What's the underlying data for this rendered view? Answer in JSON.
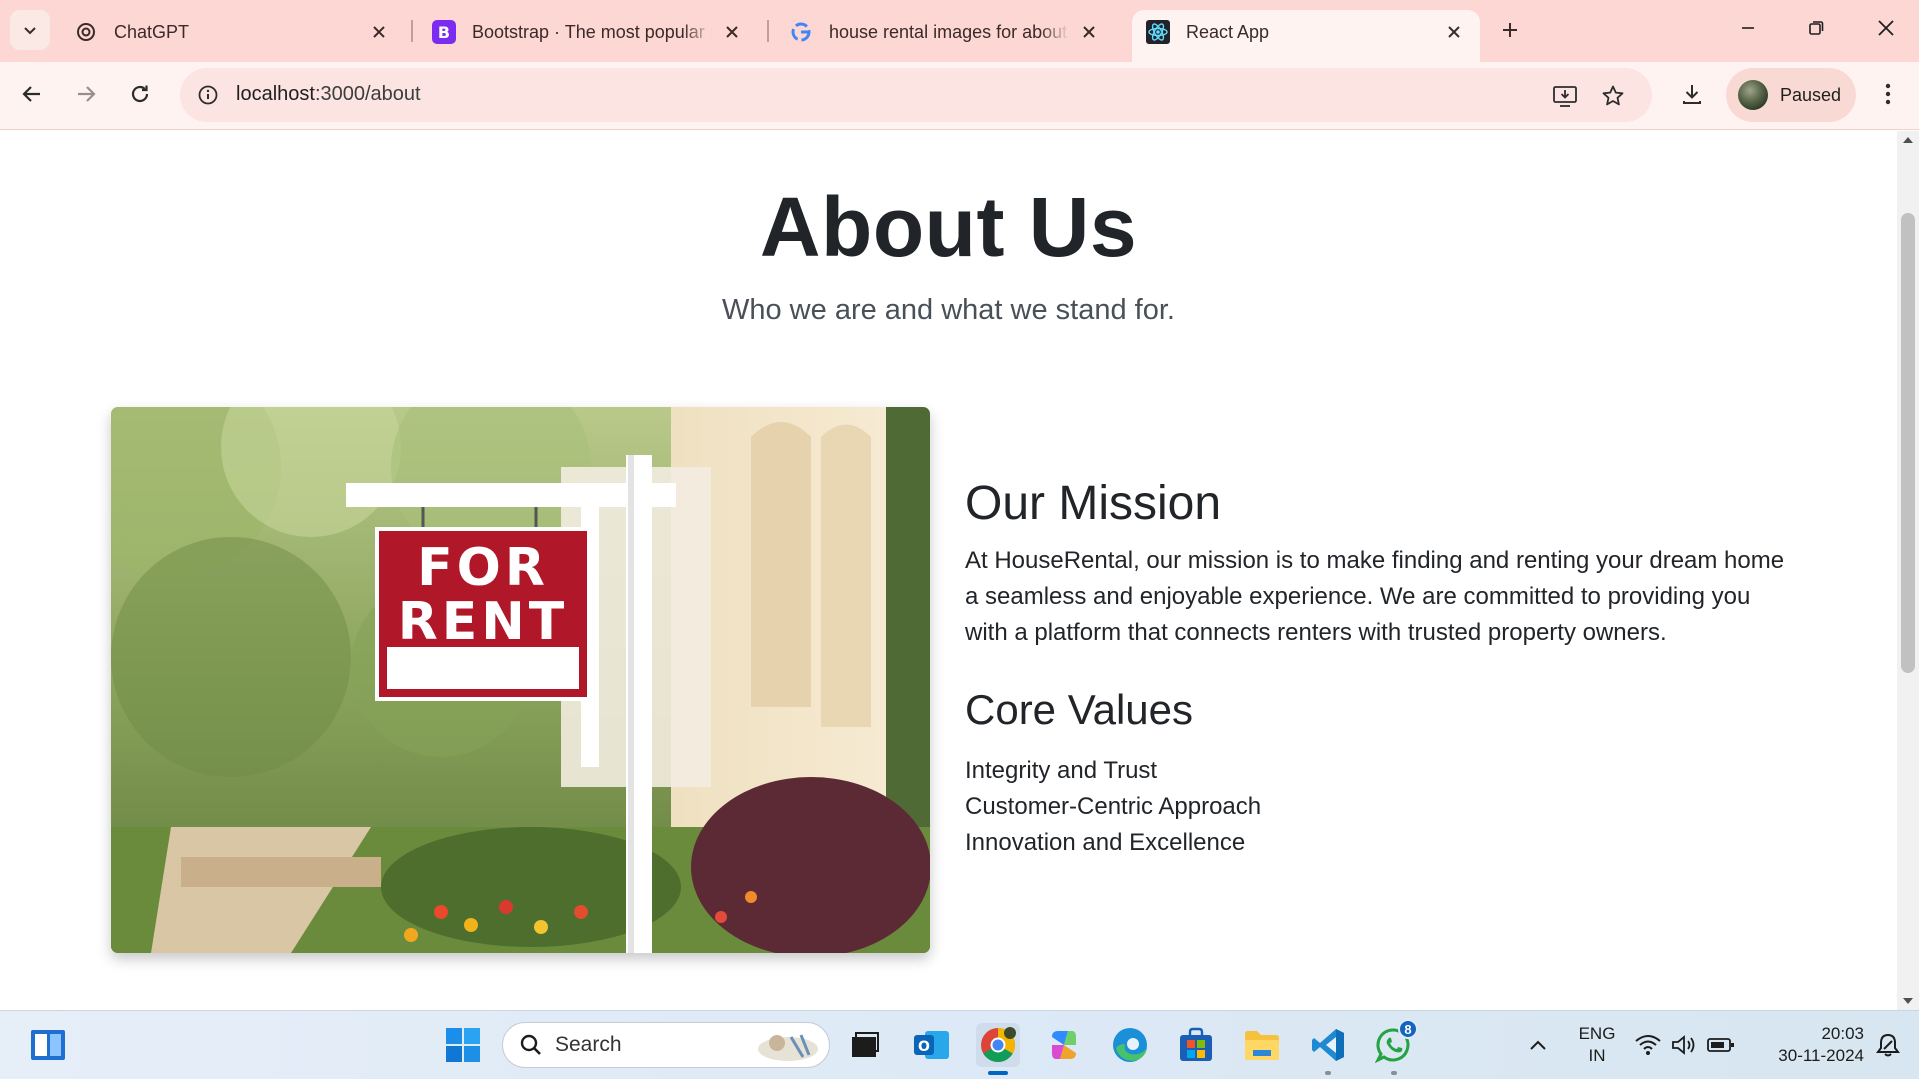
{
  "browser": {
    "tabs": [
      {
        "title": "ChatGPT",
        "icon": "chatgpt-icon"
      },
      {
        "title": "Bootstrap · The most popular HTML",
        "icon": "bootstrap-icon"
      },
      {
        "title": "house rental images for about us",
        "icon": "google-icon"
      },
      {
        "title": "React App",
        "icon": "react-icon",
        "active": true
      }
    ],
    "url_host": "localhost",
    "url_path": ":3000/about",
    "profile_label": "Paused",
    "accent_color": "#fcd7d3"
  },
  "page": {
    "title": "About Us",
    "subtitle": "Who we are and what we stand for.",
    "image": {
      "sign_line1": "FOR",
      "sign_line2": "RENT"
    },
    "mission": {
      "heading": "Our Mission",
      "text": "At HouseRental, our mission is to make finding and renting your dream home a seamless and enjoyable experience. We are committed to providing you with a platform that connects renters with trusted property owners."
    },
    "values": {
      "heading": "Core Values",
      "items": [
        "Integrity and Trust",
        "Customer-Centric Approach",
        "Innovation and Excellence"
      ]
    }
  },
  "taskbar": {
    "search_label": "Search",
    "language_line1": "ENG",
    "language_line2": "IN",
    "time": "20:03",
    "date": "30-11-2024",
    "whatsapp_badge": "8"
  }
}
